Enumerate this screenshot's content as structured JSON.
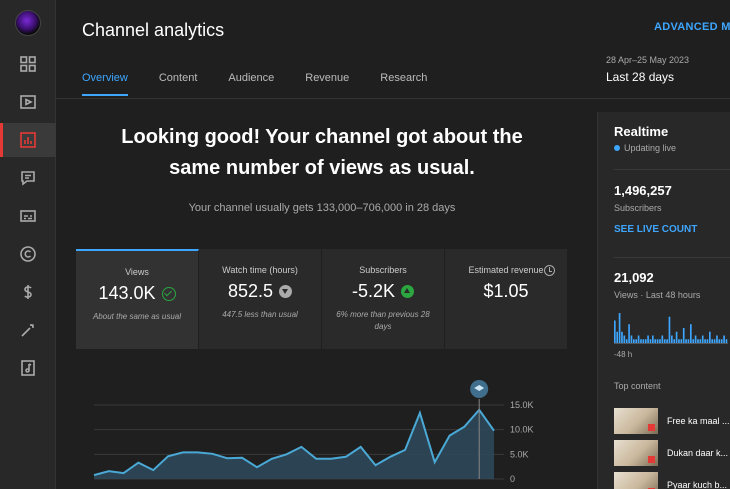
{
  "header": {
    "title": "Channel analytics",
    "advanced_label": "ADVANCED MO",
    "date_range": "28 Apr–25 May 2023",
    "date_label": "Last 28 days"
  },
  "tabs": [
    {
      "label": "Overview",
      "active": true
    },
    {
      "label": "Content",
      "active": false
    },
    {
      "label": "Audience",
      "active": false
    },
    {
      "label": "Revenue",
      "active": false
    },
    {
      "label": "Research",
      "active": false
    }
  ],
  "sidebar": {
    "items": [
      {
        "icon": "dashboard-icon"
      },
      {
        "icon": "content-icon"
      },
      {
        "icon": "analytics-icon",
        "active": true
      },
      {
        "icon": "comments-icon"
      },
      {
        "icon": "subtitles-icon"
      },
      {
        "icon": "copyright-icon"
      },
      {
        "icon": "earn-icon"
      },
      {
        "icon": "customization-icon"
      },
      {
        "icon": "audio-library-icon"
      }
    ]
  },
  "main": {
    "headline_line1": "Looking good! Your channel got about the",
    "headline_line2": "same number of views as usual.",
    "usual_text": "Your channel usually gets 133,000–706,000 in 28 days"
  },
  "cards": [
    {
      "label": "Views",
      "value": "143.0K",
      "indicator": "check-icon",
      "note": "About the same as usual",
      "active": true
    },
    {
      "label": "Watch time (hours)",
      "value": "852.5",
      "indicator": "arrow-down-icon",
      "note": "447.5 less than usual",
      "active": false
    },
    {
      "label": "Subscribers",
      "value": "-5.2K",
      "indicator": "arrow-up-icon",
      "note": "6% more than previous 28 days",
      "active": false
    },
    {
      "label": "Estimated revenue",
      "value": "$1.05",
      "indicator": "",
      "note": "",
      "active": false
    }
  ],
  "colors": {
    "accent": "#3ea6ff",
    "positive": "#2ba640",
    "active_rail": "#e53935",
    "line": "#4aa9d6",
    "area": "#2e4a5c"
  },
  "chart_data": {
    "type": "area",
    "x": [
      1,
      2,
      3,
      4,
      5,
      6,
      7,
      8,
      9,
      10,
      11,
      12,
      13,
      14,
      15,
      16,
      17,
      18,
      19,
      20,
      21,
      22,
      23,
      24,
      25,
      26,
      27,
      28
    ],
    "series": [
      {
        "values": [
          0.8,
          1.6,
          1.2,
          3.3,
          1.8,
          4.6,
          5.4,
          5.4,
          5.1,
          4.2,
          4.3,
          2.4,
          4.1,
          5.0,
          6.5,
          4.1,
          4.1,
          4.5,
          6.5,
          2.8,
          4.5,
          5.9,
          13.4,
          3.4,
          8.8,
          10.6,
          14.0,
          9.8
        ]
      }
    ],
    "yticks": [
      "15.0K",
      "10.0K",
      "5.0K",
      "0"
    ],
    "ylim": [
      0,
      15
    ],
    "grid": true
  },
  "realtime": {
    "title": "Realtime",
    "status": "Updating live",
    "subscribers_value": "1,496,257",
    "subscribers_label": "Subscribers",
    "link_label": "SEE LIVE COUNT",
    "views_value": "21,092",
    "views_label": "Views · Last 48 hours",
    "axis_label": "-48 h",
    "bars": [
      6,
      3,
      8,
      3,
      2,
      1,
      5,
      2,
      1,
      1,
      2,
      1,
      1,
      1,
      2,
      1,
      2,
      1,
      1,
      1,
      2,
      1,
      1,
      7,
      2,
      1,
      3,
      1,
      1,
      4,
      1,
      1,
      5,
      1,
      2,
      1,
      1,
      2,
      1,
      1,
      3,
      1,
      1,
      2,
      1,
      1,
      2,
      1
    ],
    "top_content_label": "Top content",
    "top_content": [
      {
        "title": "Free ka maal ..."
      },
      {
        "title": "Dukan daar k..."
      },
      {
        "title": "Pyaar kuch b..."
      }
    ]
  }
}
